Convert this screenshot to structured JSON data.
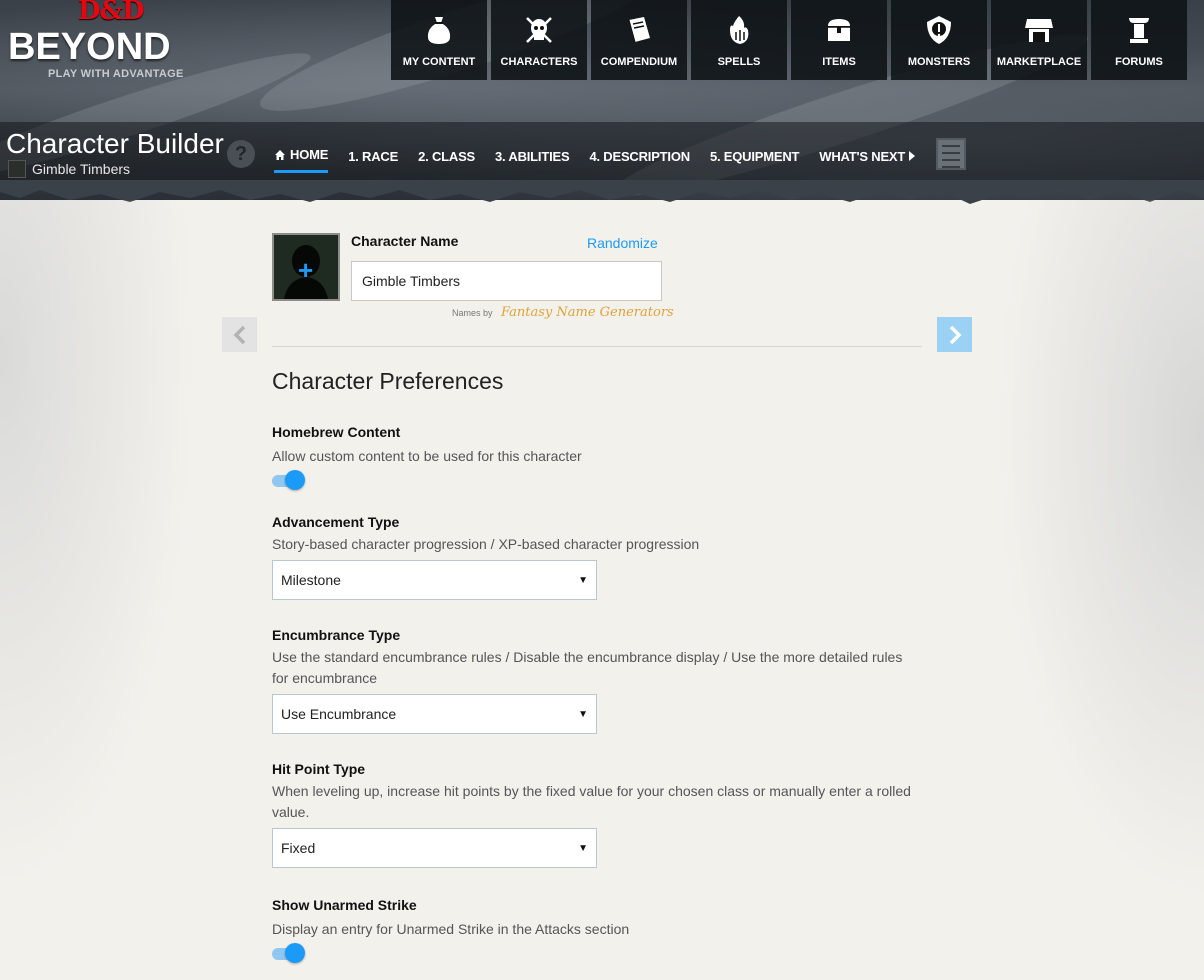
{
  "brand": {
    "dnd": "D&D",
    "name": "BEYOND",
    "tagline": "PLAY WITH ADVANTAGE"
  },
  "topnav": [
    {
      "label": "MY CONTENT",
      "icon": "bag-icon"
    },
    {
      "label": "CHARACTERS",
      "icon": "skull-helm-icon"
    },
    {
      "label": "COMPENDIUM",
      "icon": "book-icon"
    },
    {
      "label": "SPELLS",
      "icon": "fire-hand-icon"
    },
    {
      "label": "ITEMS",
      "icon": "chest-icon"
    },
    {
      "label": "MONSTERS",
      "icon": "shield-eye-icon"
    },
    {
      "label": "MARKETPLACE",
      "icon": "shop-icon"
    },
    {
      "label": "FORUMS",
      "icon": "pillar-icon"
    }
  ],
  "builder": {
    "title": "Character Builder",
    "character_name": "Gimble Timbers",
    "help": "?",
    "steps": [
      "HOME",
      "1. RACE",
      "2. CLASS",
      "3. ABILITIES",
      "4. DESCRIPTION",
      "5. EQUIPMENT",
      "WHAT'S NEXT"
    ]
  },
  "name_form": {
    "label": "Character Name",
    "randomize": "Randomize",
    "value": "Gimble Timbers",
    "names_by": "Names by",
    "generator": "Fantasy Name Generators"
  },
  "preferences": {
    "heading": "Character Preferences",
    "homebrew": {
      "title": "Homebrew Content",
      "desc": "Allow custom content to be used for this character",
      "enabled": true
    },
    "advancement": {
      "title": "Advancement Type",
      "desc": "Story-based character progression / XP-based character progression",
      "value": "Milestone"
    },
    "encumbrance": {
      "title": "Encumbrance Type",
      "desc": "Use the standard encumbrance rules / Disable the encumbrance display / Use the more detailed rules for encumbrance",
      "value": "Use Encumbrance"
    },
    "hitpoint": {
      "title": "Hit Point Type",
      "desc": "When leveling up, increase hit points by the fixed value for your chosen class or manually enter a rolled value.",
      "value": "Fixed"
    },
    "unarmed": {
      "title": "Show Unarmed Strike",
      "desc": "Display an entry for Unarmed Strike in the Attacks section",
      "enabled": true
    }
  },
  "colors": {
    "accent": "#1b9af7",
    "brand_red": "#e40712"
  }
}
